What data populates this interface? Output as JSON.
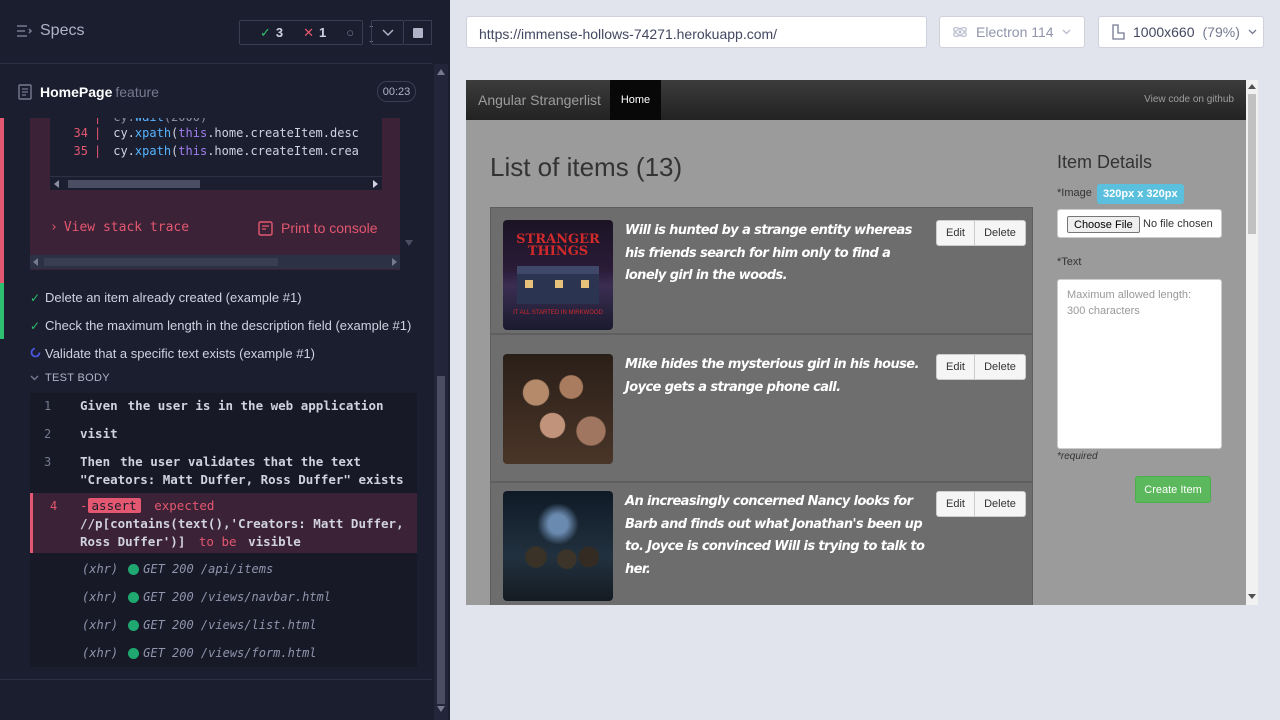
{
  "reporter": {
    "specs_label": "Specs",
    "stats": {
      "passed": "3",
      "failed": "1",
      "pending": "--"
    },
    "file": {
      "name": "HomePage",
      "suffix": "feature",
      "duration": "00:23"
    },
    "error": {
      "code_lines": [
        {
          "num": "34",
          "text_pre": "cy.",
          "fn": "xpath",
          "text_mid": "(",
          "kw": "this",
          "text_post": ".home.createItem.desc"
        },
        {
          "num": "35",
          "text_pre": "cy.",
          "fn": "xpath",
          "text_mid": "(",
          "kw": "this",
          "text_post": ".home.createItem.crea"
        }
      ],
      "stack_link": "View stack trace",
      "print_button": "Print to console"
    },
    "tests": [
      {
        "title": "Delete an item already created (example #1)",
        "state": "passed"
      },
      {
        "title": "Check the maximum length in the description field (example #1)",
        "state": "passed"
      },
      {
        "title": "Validate that a specific text exists (example #1)",
        "state": "running"
      }
    ],
    "test_body_label": "TEST BODY",
    "commands": [
      {
        "num": "1",
        "keyword": "Given",
        "text": "the user is in the web application"
      },
      {
        "num": "2",
        "keyword": "",
        "text": "visit"
      },
      {
        "num": "3",
        "keyword": "Then",
        "text": "the user validates that the text",
        "text2": "\"Creators: Matt Duffer, Ross Duffer\" exists"
      }
    ],
    "failed_command": {
      "num": "4",
      "prefix": "-",
      "tag": "assert",
      "word1": "expected",
      "line2": "//p[contains(text(),'Creators: Matt Duffer,",
      "line3a": "Ross Duffer')]",
      "word2": "to be",
      "word3": "visible"
    },
    "xhr": [
      {
        "tag": "(xhr)",
        "text": "GET 200 /api/items"
      },
      {
        "tag": "(xhr)",
        "text": "GET 200 /views/navbar.html"
      },
      {
        "tag": "(xhr)",
        "text": "GET 200 /views/list.html"
      },
      {
        "tag": "(xhr)",
        "text": "GET 200 /views/form.html"
      }
    ]
  },
  "browser": {
    "url": "https://immense-hollows-74271.herokuapp.com/",
    "browser_name": "Electron 114",
    "viewport": "1000x660",
    "zoom": "(79%)"
  },
  "app": {
    "brand": "Angular Strangerlist",
    "nav_home": "Home",
    "nav_github": "View code on github",
    "list_title": "List of items (13)",
    "items": [
      {
        "text": "Will is hunted by a strange entity whereas his friends search for him only to find a lonely girl in the woods.",
        "edit": "Edit",
        "delete": "Delete"
      },
      {
        "text": "Mike hides the mysterious girl in his house. Joyce gets a strange phone call.",
        "edit": "Edit",
        "delete": "Delete"
      },
      {
        "text": "An increasingly concerned Nancy looks for Barb and finds out what Jonathan's been up to. Joyce is convinced Will is trying to talk to her.",
        "edit": "Edit",
        "delete": "Delete"
      }
    ],
    "poster_text": "STRANGER THINGS",
    "poster_subtext": "IT ALL STARTED IN MIRKWOOD",
    "details": {
      "title": "Item Details",
      "image_label": "*Image",
      "image_badge": "320px x 320px",
      "choose_file": "Choose File",
      "no_file": "No file chosen",
      "text_label": "*Text",
      "text_placeholder": "Maximum allowed length: 300 characters",
      "required": "*required",
      "create_button": "Create Item"
    }
  },
  "colors": {
    "pass": "#2ec070",
    "fail": "#e45770",
    "accent": "#5bc0de",
    "create": "#5cb85c"
  }
}
